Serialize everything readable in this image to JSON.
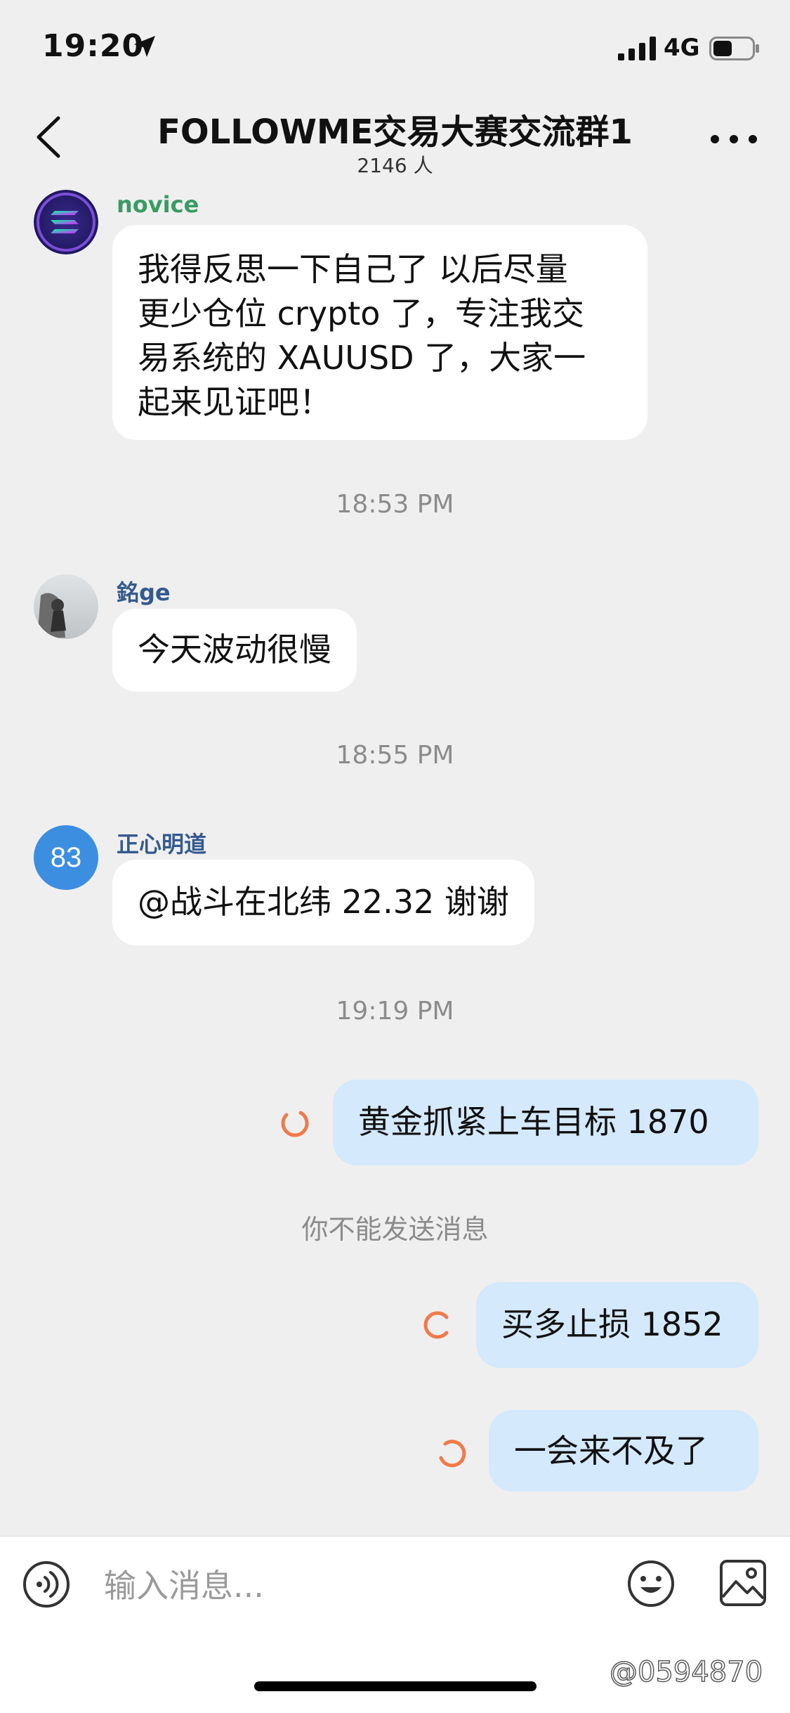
{
  "status_bar": {
    "time": "19:20",
    "network": "4G"
  },
  "header": {
    "title": "FOLLOWME交易大赛交流群1",
    "member_count": "2146 人"
  },
  "messages": [
    {
      "sender": "novice",
      "sender_color": "#3a9b63",
      "lines": [
        "我得反思一下自己了 以后尽量",
        "更少仓位 crypto 了，专注我交",
        "易系统的 XAUUSD 了，大家一",
        "起来见证吧！"
      ]
    },
    {
      "sender": "銘ge",
      "sender_color": "#355a8e",
      "text": "今天波动很慢"
    },
    {
      "sender": "正心明道",
      "sender_color": "#355a8e",
      "avatar_text": "83",
      "avatar_color": "#3c8ee0",
      "text": "@战斗在北纬 22.32 谢谢"
    }
  ],
  "timestamps": [
    "18:53 PM",
    "18:55 PM",
    "19:19 PM"
  ],
  "outgoing": [
    {
      "text": "黄金抓紧上车目标 1870",
      "status": "sending"
    },
    {
      "text": "买多止损 1852",
      "status": "sending"
    },
    {
      "text": "一会来不及了",
      "status": "sending"
    }
  ],
  "system_note": "你不能发送消息",
  "input": {
    "placeholder": "输入消息..."
  },
  "watermark": "@0594870",
  "colors": {
    "background": "#efeff0",
    "outgoing_bubble": "#d4e9fb",
    "spinner": "#f07a4a"
  }
}
